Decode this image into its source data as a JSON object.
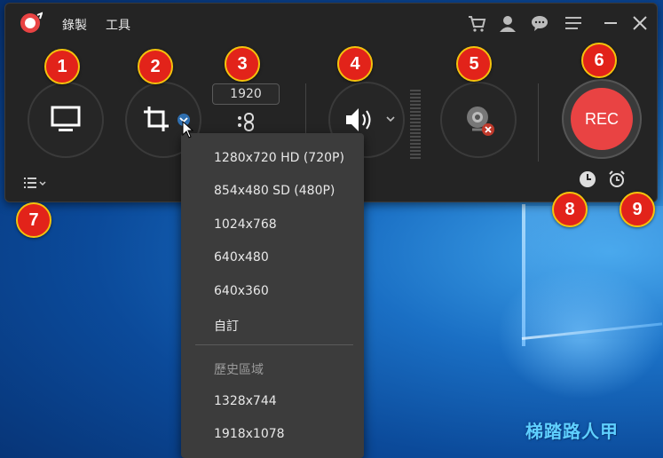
{
  "desktop": {
    "watermark": "梯踏路人甲"
  },
  "titlebar": {
    "menu": [
      "錄製",
      "工具"
    ],
    "icons": [
      "cart-icon",
      "account-icon",
      "chat-icon",
      "menu-icon",
      "minimize-icon",
      "close-icon"
    ]
  },
  "controls": {
    "resolution_value": "1920",
    "rec_label": "REC"
  },
  "badges": [
    "1",
    "2",
    "3",
    "4",
    "5",
    "6",
    "7",
    "8",
    "9"
  ],
  "dropdown": {
    "items": [
      "1280x720 HD (720P)",
      "854x480 SD (480P)",
      "1024x768",
      "640x480",
      "640x360",
      "自訂"
    ],
    "history_header": "歷史區域",
    "history_items": [
      "1328x744",
      "1918x1078"
    ]
  },
  "colors": {
    "accent": "#e94343",
    "badge": "#e2231a",
    "badge_border": "#f4c20d",
    "window": "#242424"
  }
}
